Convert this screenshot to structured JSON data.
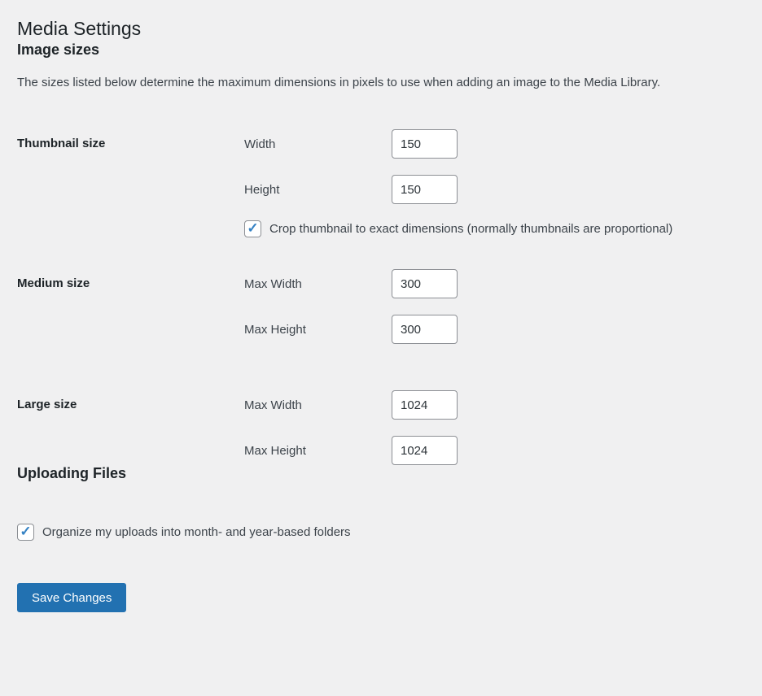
{
  "page": {
    "title": "Media Settings"
  },
  "image_sizes": {
    "heading": "Image sizes",
    "description": "The sizes listed below determine the maximum dimensions in pixels to use when adding an image to the Media Library.",
    "thumbnail": {
      "label": "Thumbnail size",
      "fields": [
        {
          "label": "Width",
          "value": "150"
        },
        {
          "label": "Height",
          "value": "150"
        }
      ],
      "crop_checkbox": {
        "label": "Crop thumbnail to exact dimensions (normally thumbnails are proportional)",
        "checked": true
      }
    },
    "medium": {
      "label": "Medium size",
      "fields": [
        {
          "label": "Max Width",
          "value": "300"
        },
        {
          "label": "Max Height",
          "value": "300"
        }
      ]
    },
    "large": {
      "label": "Large size",
      "fields": [
        {
          "label": "Max Width",
          "value": "1024"
        },
        {
          "label": "Max Height",
          "value": "1024"
        }
      ]
    }
  },
  "uploading_files": {
    "heading": "Uploading Files",
    "organize_checkbox": {
      "label": "Organize my uploads into month- and year-based folders",
      "checked": true
    }
  },
  "submit": {
    "save_label": "Save Changes"
  },
  "icons": {
    "checkmark": "✓"
  },
  "colors": {
    "background": "#f0f0f1",
    "heading_text": "#1d2327",
    "body_text": "#3c434a",
    "input_border": "#8c8f94",
    "checkmark_blue": "#3582c4",
    "button_blue": "#2271b1"
  }
}
